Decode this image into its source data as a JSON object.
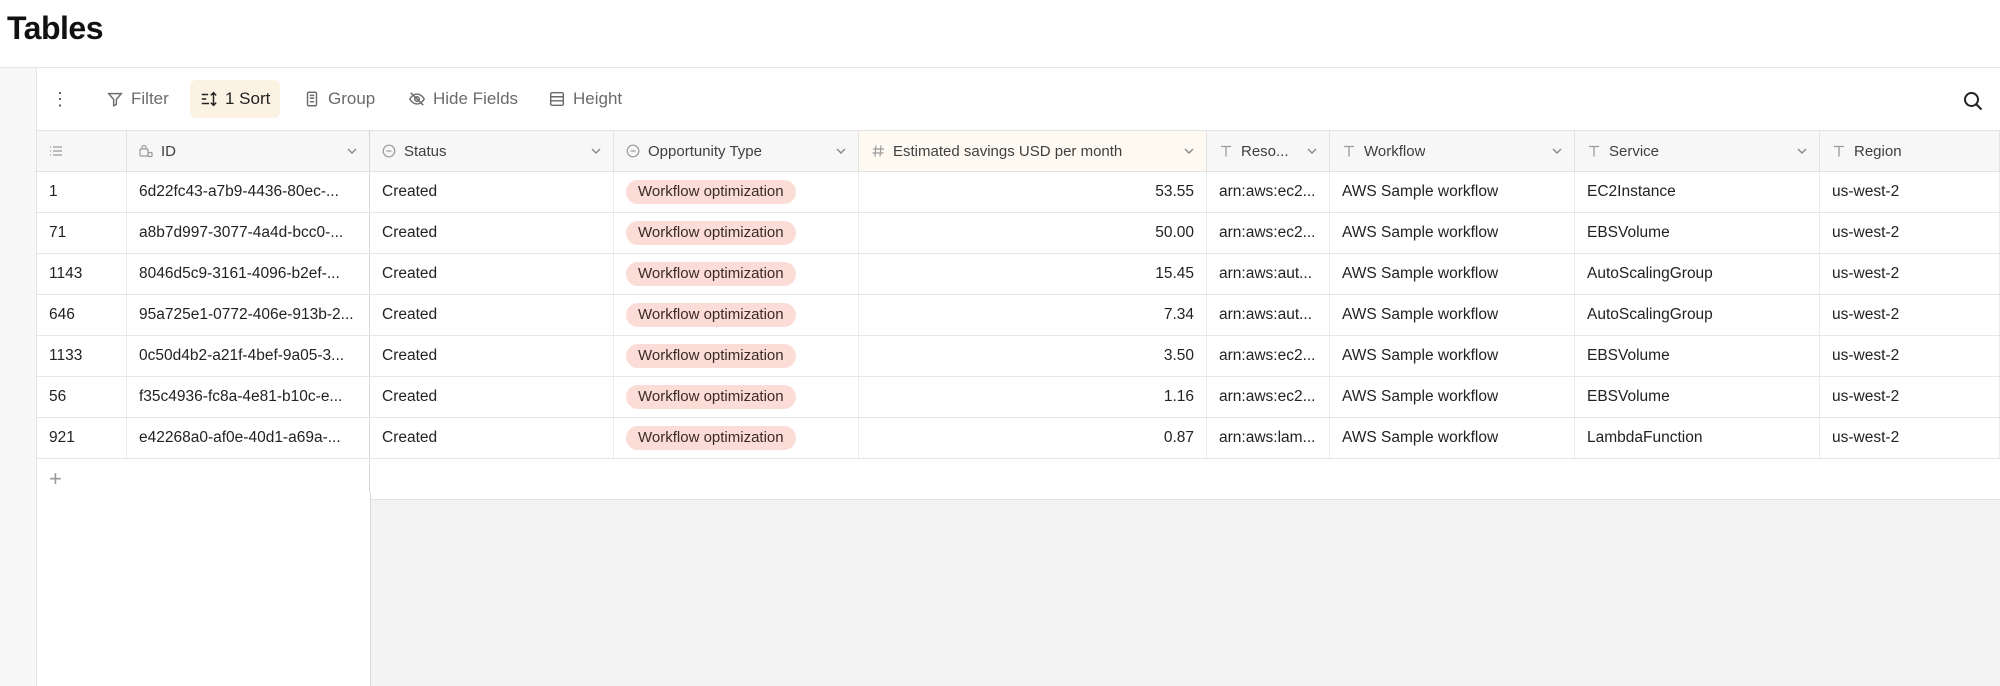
{
  "page": {
    "title": "Tables"
  },
  "toolbar": {
    "filter": "Filter",
    "sort": "1 Sort",
    "group": "Group",
    "hide_fields": "Hide Fields",
    "height": "Height"
  },
  "columns": [
    {
      "key": "rownum",
      "label": "",
      "icon": "list-icon"
    },
    {
      "key": "id",
      "label": "ID",
      "icon": "lock-key-icon"
    },
    {
      "key": "status",
      "label": "Status",
      "icon": "status-icon"
    },
    {
      "key": "type",
      "label": "Opportunity Type",
      "icon": "status-icon"
    },
    {
      "key": "savings",
      "label": "Estimated savings USD per month",
      "icon": "hash-icon"
    },
    {
      "key": "resource",
      "label": "Reso...",
      "icon": "text-icon"
    },
    {
      "key": "workflow",
      "label": "Workflow",
      "icon": "text-icon"
    },
    {
      "key": "service",
      "label": "Service",
      "icon": "text-icon"
    },
    {
      "key": "region",
      "label": "Region",
      "icon": "text-icon"
    }
  ],
  "rows": [
    {
      "rownum": "1",
      "id": "6d22fc43-a7b9-4436-80ec-...",
      "status": "Created",
      "type": "Workflow optimization",
      "savings": "53.55",
      "resource": "arn:aws:ec2...",
      "workflow": "AWS Sample workflow",
      "service": "EC2Instance",
      "region": "us-west-2"
    },
    {
      "rownum": "71",
      "id": "a8b7d997-3077-4a4d-bcc0-...",
      "status": "Created",
      "type": "Workflow optimization",
      "savings": "50.00",
      "resource": "arn:aws:ec2...",
      "workflow": "AWS Sample workflow",
      "service": "EBSVolume",
      "region": "us-west-2"
    },
    {
      "rownum": "1143",
      "id": "8046d5c9-3161-4096-b2ef-...",
      "status": "Created",
      "type": "Workflow optimization",
      "savings": "15.45",
      "resource": "arn:aws:aut...",
      "workflow": "AWS Sample workflow",
      "service": "AutoScalingGroup",
      "region": "us-west-2"
    },
    {
      "rownum": "646",
      "id": "95a725e1-0772-406e-913b-2...",
      "status": "Created",
      "type": "Workflow optimization",
      "savings": "7.34",
      "resource": "arn:aws:aut...",
      "workflow": "AWS Sample workflow",
      "service": "AutoScalingGroup",
      "region": "us-west-2"
    },
    {
      "rownum": "1133",
      "id": "0c50d4b2-a21f-4bef-9a05-3...",
      "status": "Created",
      "type": "Workflow optimization",
      "savings": "3.50",
      "resource": "arn:aws:ec2...",
      "workflow": "AWS Sample workflow",
      "service": "EBSVolume",
      "region": "us-west-2"
    },
    {
      "rownum": "56",
      "id": "f35c4936-fc8a-4e81-b10c-e...",
      "status": "Created",
      "type": "Workflow optimization",
      "savings": "1.16",
      "resource": "arn:aws:ec2...",
      "workflow": "AWS Sample workflow",
      "service": "EBSVolume",
      "region": "us-west-2"
    },
    {
      "rownum": "921",
      "id": "e42268a0-af0e-40d1-a69a-...",
      "status": "Created",
      "type": "Workflow optimization",
      "savings": "0.87",
      "resource": "arn:aws:lam...",
      "workflow": "AWS Sample workflow",
      "service": "LambdaFunction",
      "region": "us-west-2"
    }
  ],
  "add_row": {
    "symbol": "+"
  },
  "colors": {
    "pill_bg": "#fbdcd6",
    "sort_active_bg": "#fbf2e4",
    "grid_bg": "#f3f3f3"
  }
}
